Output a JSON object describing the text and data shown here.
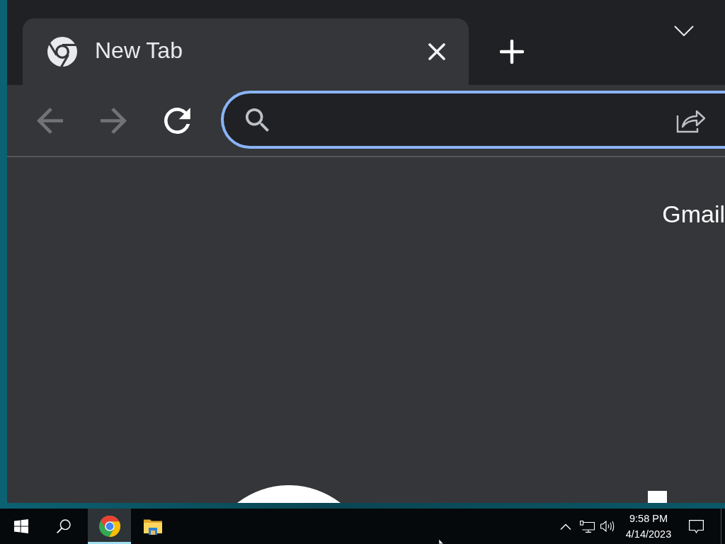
{
  "browser": {
    "tabs": [
      {
        "title": "New Tab",
        "selected": true
      }
    ],
    "nav_buttons": [
      {
        "kind": "back",
        "disabled": true
      },
      {
        "kind": "forward",
        "disabled": true
      },
      {
        "kind": "reload",
        "disabled": false
      }
    ],
    "address_bar": {
      "focused": true
    },
    "page": {
      "top_links": [
        "Gmail"
      ]
    }
  },
  "taskbar": {
    "apps": [
      {
        "kind": "chrome",
        "selected": true
      },
      {
        "kind": "file-explorer",
        "selected": false
      }
    ],
    "clock": {
      "time": "9:58 PM",
      "date": "4/14/2023"
    }
  }
}
